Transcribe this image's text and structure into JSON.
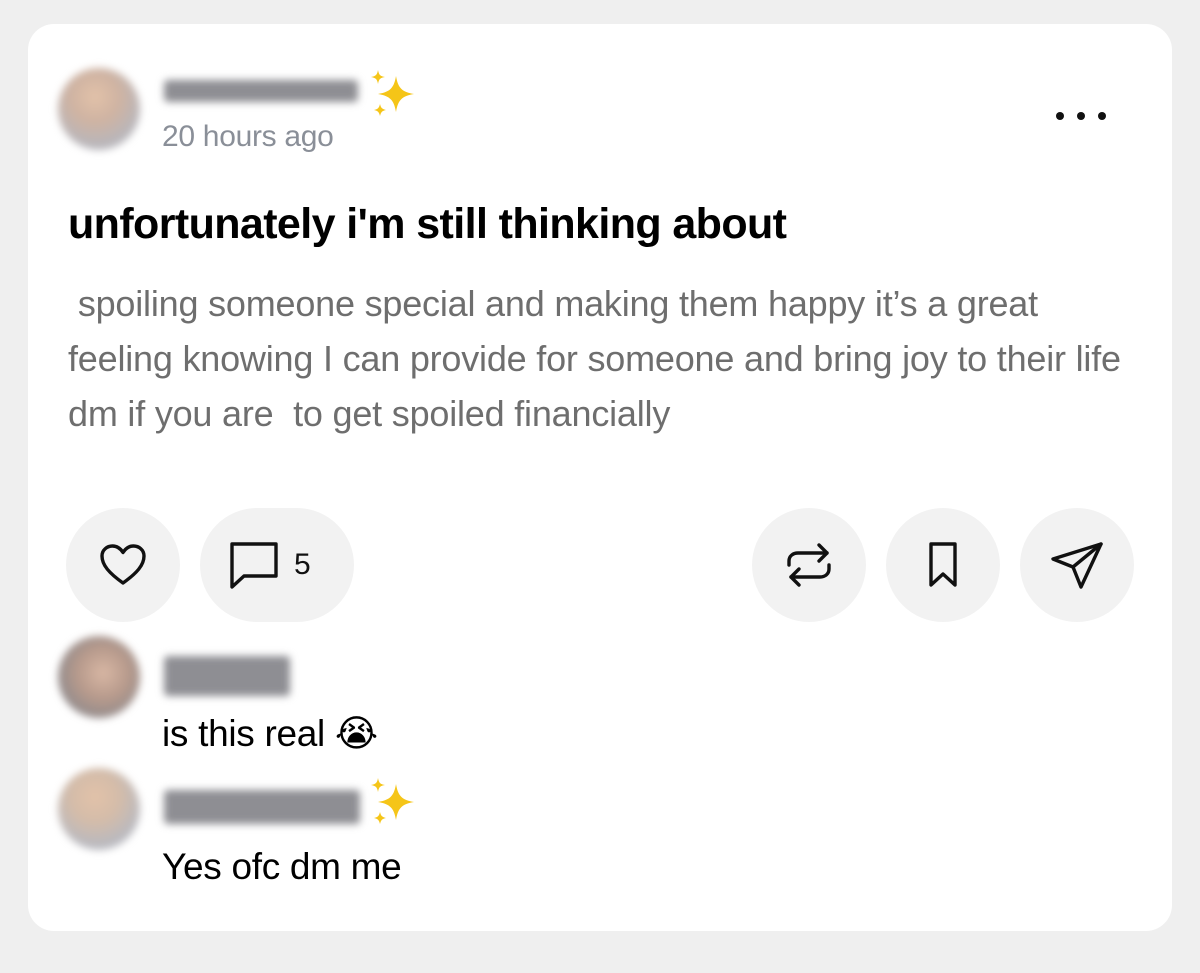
{
  "post": {
    "author_name": "",
    "timestamp": "20 hours ago",
    "title": "unfortunately i'm still thinking about",
    "body": " spoiling someone special and making them happy it’s a great feeling knowing I can provide for someone and bring joy to their life dm if you are  to get spoiled financially",
    "actions": {
      "like_icon": "heart-icon",
      "comment_icon": "comment-icon",
      "comment_count": "5",
      "repost_icon": "repost-icon",
      "save_icon": "bookmark-icon",
      "share_icon": "send-icon"
    },
    "more_icon": "more-horizontal-icon"
  },
  "comments": [
    {
      "author_name": "",
      "text": "is this real 😭"
    },
    {
      "author_name": "",
      "text": "Yes ofc dm me"
    }
  ],
  "colors": {
    "background": "#efefef",
    "card": "#ffffff",
    "action_button": "#f2f2f2",
    "muted_text": "#8a8f98",
    "body_text": "#6e6e6e",
    "sparkle": "#f5c518"
  }
}
